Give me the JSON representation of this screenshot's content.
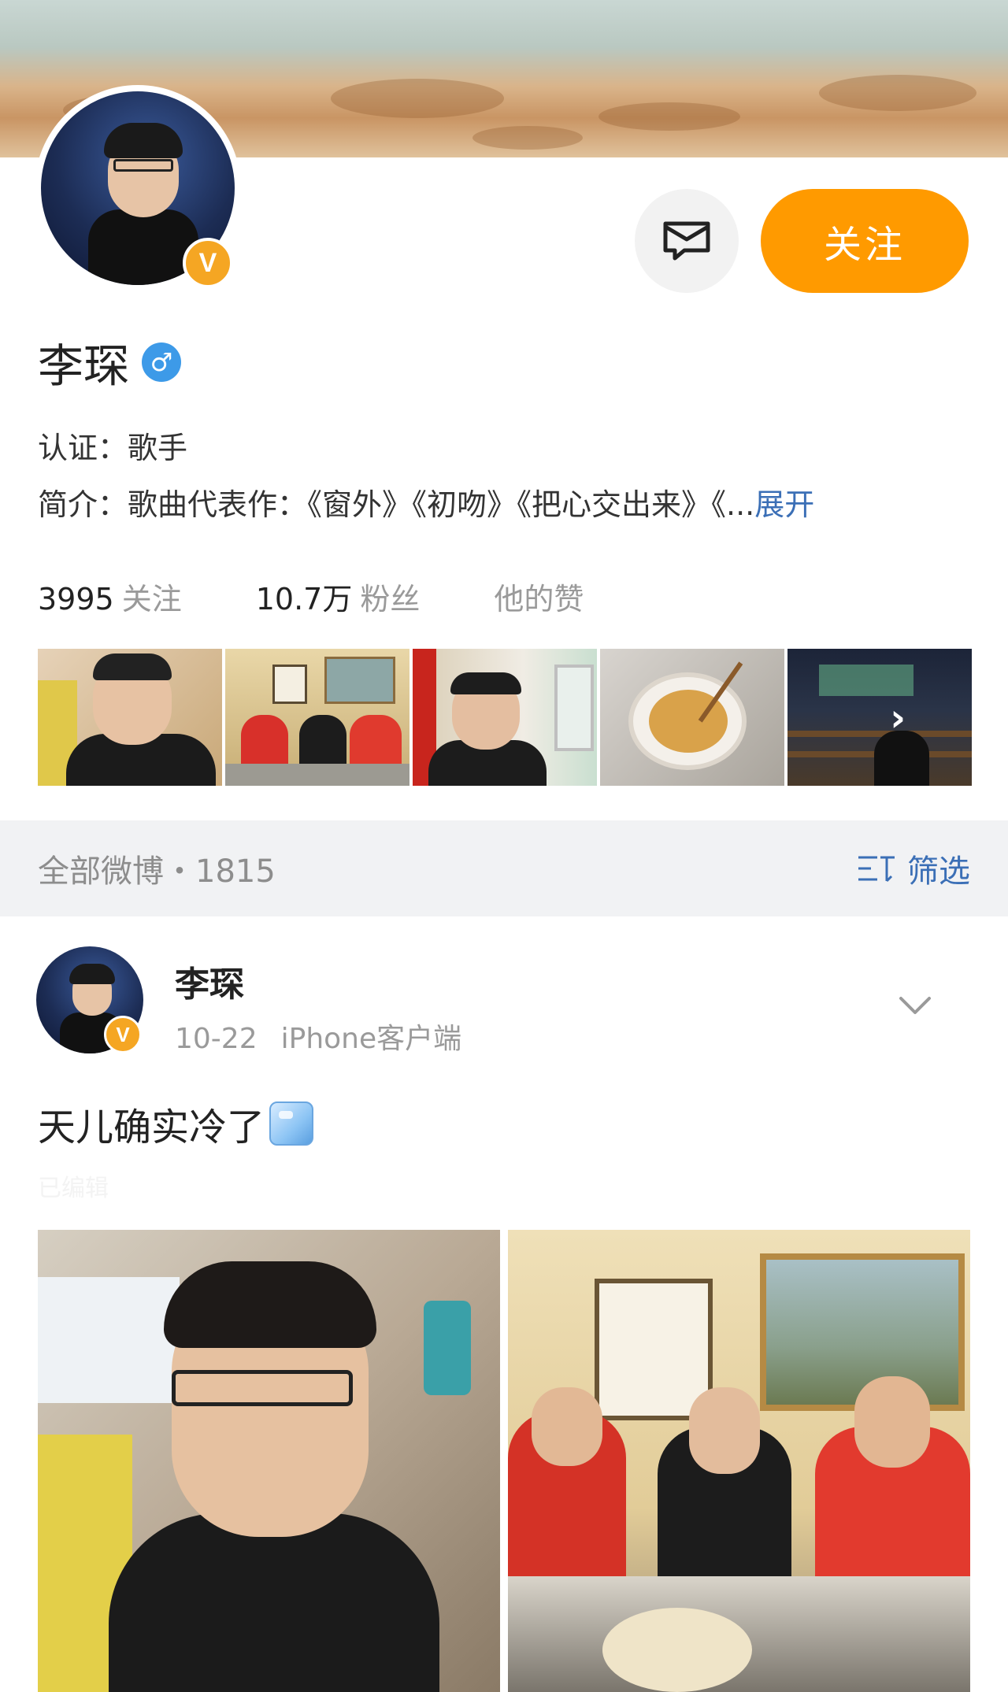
{
  "profile": {
    "name": "李琛",
    "gender_symbol": "♂",
    "verified_badge": "V",
    "message_icon": "mail-icon",
    "follow_label": "关注",
    "certification": "认证：歌手",
    "bio": "简介：歌曲代表作：《窗外》《初吻》《把心交出来》《...",
    "bio_expand": "展开",
    "stats": {
      "following_count": "3995",
      "following_label": "关注",
      "fans_count": "10.7万",
      "fans_label": "粉丝",
      "likes_label": "他的赞"
    },
    "album_more_icon": "›"
  },
  "feed": {
    "section_title": "全部微博・1815",
    "filter_icon": "filter-icon",
    "filter_label": "筛选"
  },
  "post": {
    "author": "李琛",
    "date": "10-22",
    "source": "iPhone客户端",
    "text": "天儿确实冷了",
    "emoji": "ice-cube-icon",
    "faint_text": "已编辑"
  },
  "colors": {
    "accent_orange": "#ff9a00",
    "link_blue": "#3b6fb6",
    "verify_gold": "#f5a623",
    "gender_blue": "#3d9ae8"
  }
}
